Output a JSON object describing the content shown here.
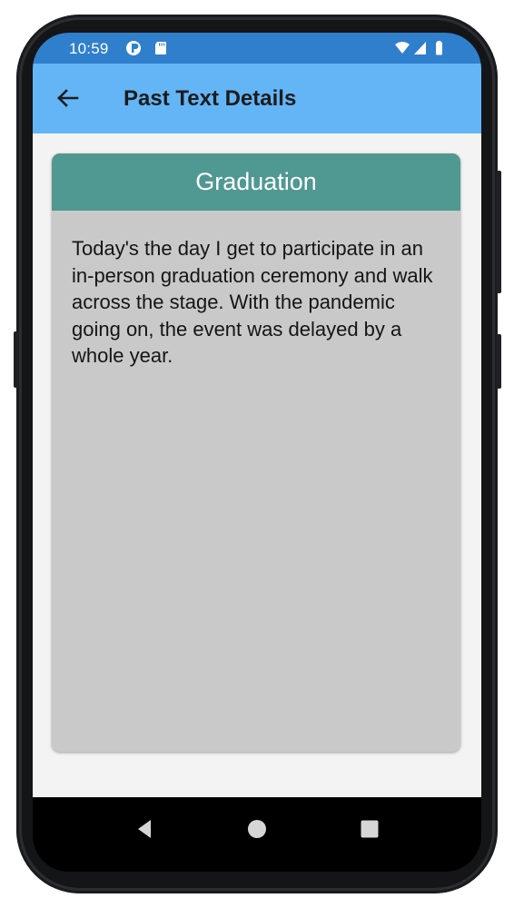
{
  "status_bar": {
    "time": "10:59",
    "icons": [
      "data-saver-icon",
      "sd-card-icon",
      "wifi-icon",
      "signal-icon",
      "battery-icon"
    ]
  },
  "app_bar": {
    "back_icon": "arrow-left-icon",
    "title": "Past Text Details"
  },
  "card": {
    "title": "Graduation",
    "body": "Today's the day I get to participate in an in-person graduation ceremony and walk across the stage. With the pandemic going on, the event was delayed by a whole year."
  },
  "nav_bar": {
    "icons": [
      "back-triangle-icon",
      "home-circle-icon",
      "recents-square-icon"
    ]
  },
  "colors": {
    "status_bar": "#2f7fcd",
    "app_bar": "#64b5f6",
    "card_header": "#509892",
    "card_body": "#c9c9c9",
    "background": "#f3f3f3"
  }
}
